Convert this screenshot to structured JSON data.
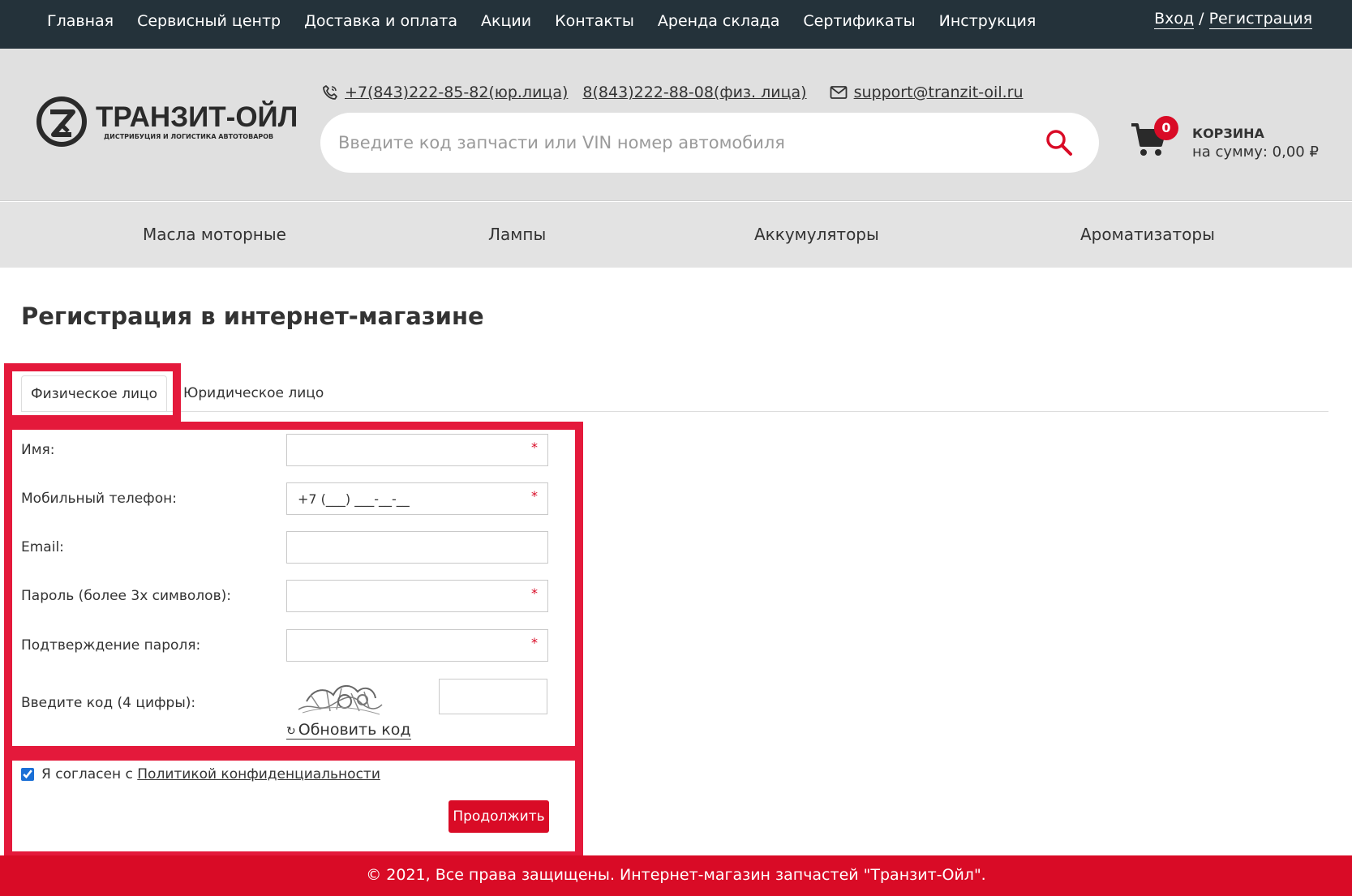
{
  "topnav": {
    "items": [
      "Главная",
      "Сервисный центр",
      "Доставка и оплата",
      "Акции",
      "Контакты",
      "Аренда склада",
      "Сертификаты",
      "Инструкция"
    ],
    "login": "Вход",
    "separator": " / ",
    "register": "Регистрация"
  },
  "header": {
    "logo_name": "ТРАНЗИТ-ОЙЛ",
    "logo_sub": "ДИСТРИБУЦИЯ И ЛОГИСТИКА АВТОТОВАРОВ",
    "phone_legal": "+7(843)222-85-82(юр.лица)",
    "phone_private": "8(843)222-88-08(физ. лица)",
    "email": "support@tranzit-oil.ru",
    "search_placeholder": "Введите код запчасти или VIN номер автомобиля",
    "cart_count": "0",
    "cart_title": "КОРЗИНА",
    "cart_sum": "на сумму: 0,00 ₽"
  },
  "categories": [
    "Масла моторные",
    "Лампы",
    "Аккумуляторы",
    "Ароматизаторы"
  ],
  "main": {
    "title": "Регистрация в интернет-магазине",
    "tabs": [
      {
        "label": "Физическое лицо",
        "active": true
      },
      {
        "label": "Юридическое лицо",
        "active": false
      }
    ],
    "fields": [
      {
        "label": "Имя:",
        "value": "",
        "required": true
      },
      {
        "label": "Мобильный телефон:",
        "value": "+7 (___) ___-__-__",
        "required": true
      },
      {
        "label": "Email:",
        "value": "",
        "required": false
      },
      {
        "label": "Пароль (более 3х символов):",
        "value": "",
        "required": true
      },
      {
        "label": "Подтверждение пароля:",
        "value": "",
        "required": true
      }
    ],
    "required_mark": "*",
    "captcha_label": "Введите код (4 цифры):",
    "captcha_refresh": "Обновить код",
    "agree_prefix": "Я согласен с ",
    "agree_link": "Политикой конфиденциальности",
    "agree_checked": true,
    "continue_label": "Продолжить"
  },
  "footer": {
    "text": "© 2021, Все права защищены. Интернет-магазин запчастей \"Транзит-Ойл\"."
  },
  "colors": {
    "topbar": "#24323a",
    "accent": "#d90b26",
    "highlight": "#e4193b",
    "header_bg": "#e0e0e0"
  }
}
